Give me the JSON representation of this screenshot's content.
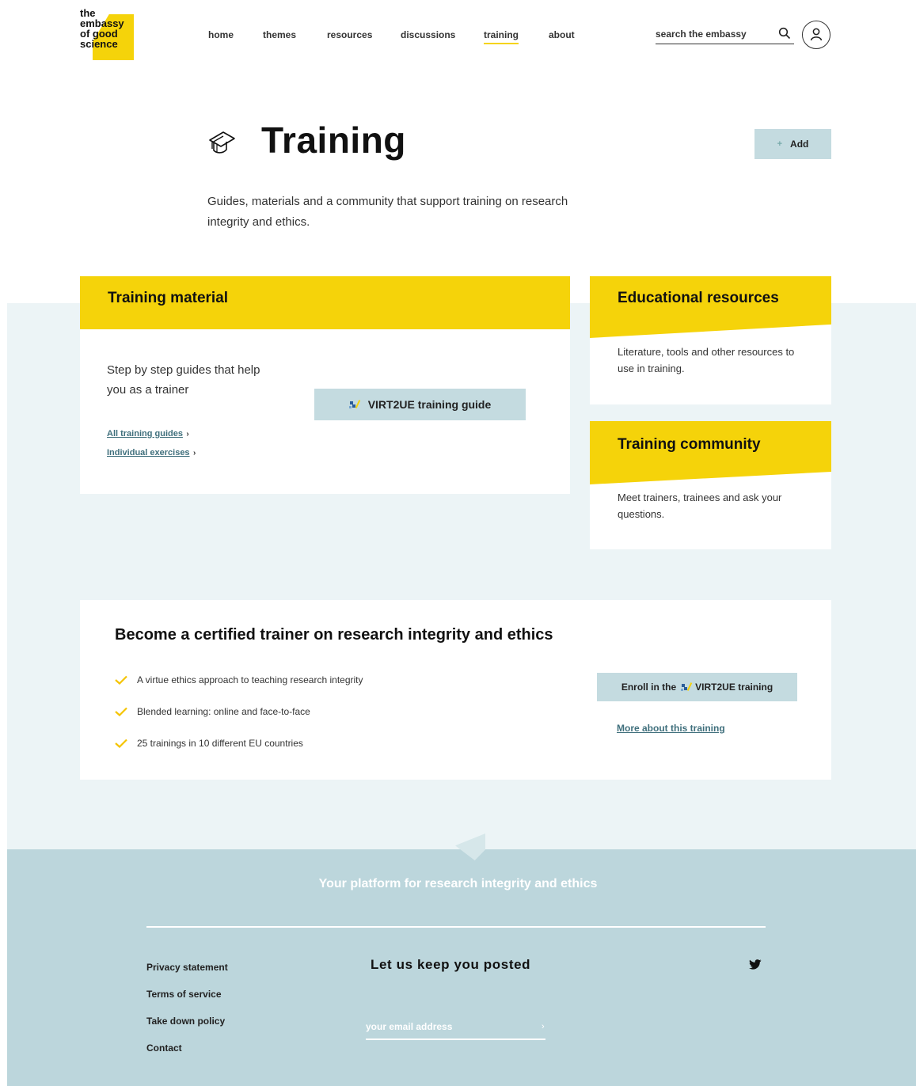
{
  "header": {
    "logo_lines": [
      "the",
      "embassy",
      "of good",
      "science"
    ],
    "nav": [
      {
        "label": "home",
        "active": false
      },
      {
        "label": "themes",
        "active": false
      },
      {
        "label": "resources",
        "active": false
      },
      {
        "label": "discussions",
        "active": false
      },
      {
        "label": "training",
        "active": true
      },
      {
        "label": "about",
        "active": false
      }
    ],
    "search_placeholder": "search the embassy",
    "search_icon": "search-icon",
    "user_icon": "user-icon"
  },
  "page": {
    "title": "Training",
    "title_icon": "graduation-cap-icon",
    "add_label": "Add",
    "add_icon": "plus-icon",
    "intro": "Guides, materials and a community that support training on research integrity and ethics."
  },
  "training_material": {
    "title": "Training material",
    "text": "Step by step guides that help you as a trainer",
    "links": [
      {
        "label": "All training guides",
        "arrow": "›"
      },
      {
        "label": "Individual exercises",
        "arrow": "›"
      }
    ],
    "guide_button": "VIRT2UE training guide"
  },
  "educational_resources": {
    "title": "Educational resources",
    "text": "Literature, tools and other resources to use in training."
  },
  "training_community": {
    "title": "Training community",
    "text": "Meet trainers, trainees and ask your questions."
  },
  "certified": {
    "title": "Become a certified trainer on research integrity and ethics",
    "items": [
      "A virtue ethics approach to teaching research integrity",
      "Blended learning: online and face-to-face",
      "25 trainings in 10 different EU countries"
    ],
    "enroll_prefix": "Enroll in the",
    "enroll_suffix": "VIRT2UE training",
    "more_link": "More about this training"
  },
  "footer": {
    "tagline": "Your platform for research integrity and ethics",
    "links": [
      "Privacy statement",
      "Terms of service",
      "Take down policy",
      "Contact"
    ],
    "newsletter_title": "Let us keep you posted",
    "email_placeholder": "your email address",
    "submit_arrow": "›",
    "social_icon": "twitter-icon"
  },
  "colors": {
    "accent_yellow": "#f5d30a",
    "button_blue": "#c4dbe0",
    "band_light": "#ecf4f6",
    "footer_bg": "#bcd6dc",
    "link_teal": "#3f6f7c"
  }
}
